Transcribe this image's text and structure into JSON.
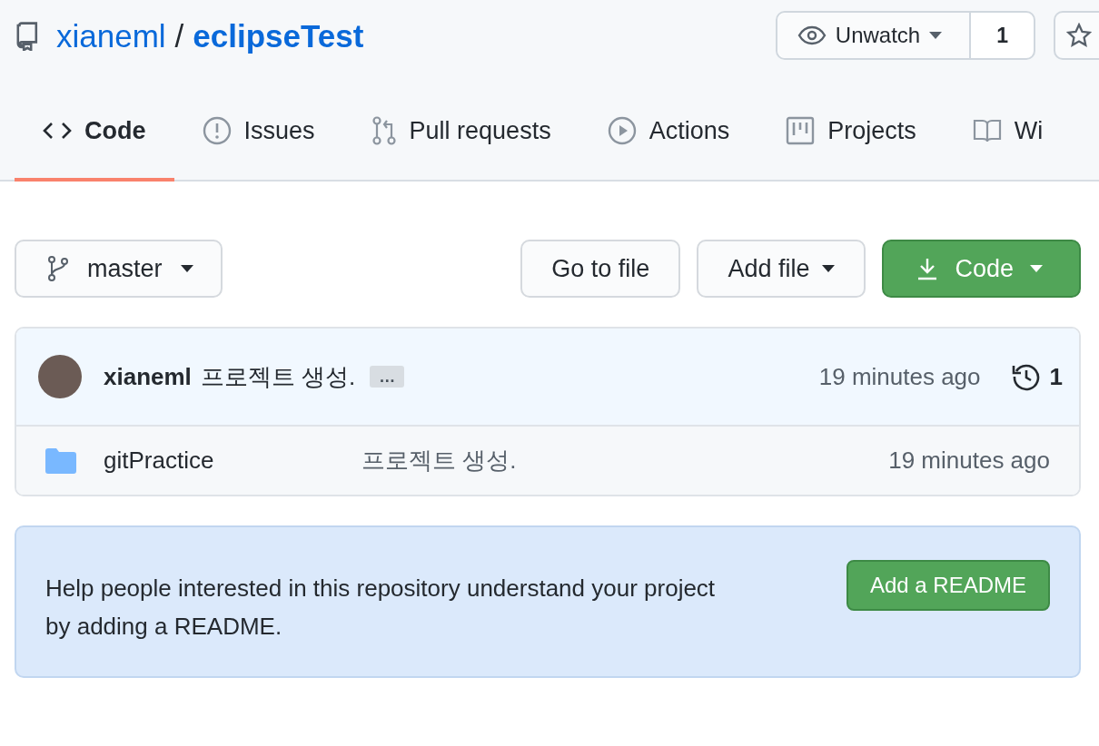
{
  "repo": {
    "owner": "xianeml",
    "separator": "/",
    "name": "eclipseTest"
  },
  "watch": {
    "label": "Unwatch",
    "count": "1"
  },
  "tabs": [
    {
      "label": "Code",
      "kind": "code",
      "selected": true
    },
    {
      "label": "Issues",
      "kind": "issue",
      "selected": false
    },
    {
      "label": "Pull requests",
      "kind": "pull",
      "selected": false
    },
    {
      "label": "Actions",
      "kind": "play",
      "selected": false
    },
    {
      "label": "Projects",
      "kind": "project",
      "selected": false
    },
    {
      "label": "Wi",
      "kind": "book",
      "selected": false
    }
  ],
  "branch": {
    "label": "master"
  },
  "actions": [
    {
      "label": "Go to file",
      "kind": "plain"
    },
    {
      "label": "Add file",
      "kind": "dropdown"
    },
    {
      "label": "Code",
      "kind": "primary"
    }
  ],
  "commit": {
    "author": "xianeml",
    "message": "프로젝트 생성.",
    "more": "…",
    "time": "19 minutes ago",
    "count": "1"
  },
  "files": [
    {
      "name": "gitPractice",
      "message": "프로젝트 생성.",
      "time": "19 minutes ago",
      "kind": "folder"
    }
  ],
  "readme": {
    "text": "Help people interested in this repository understand your project by adding a README.",
    "button": "Add a README"
  }
}
